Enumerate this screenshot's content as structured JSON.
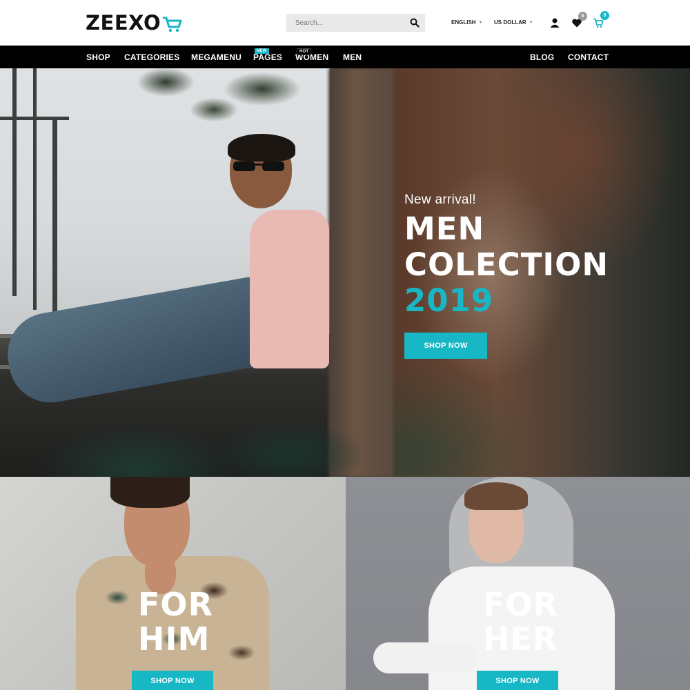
{
  "header": {
    "logo_text": "ZEEXO",
    "search_placeholder": "Search...",
    "language": "ENGLISH",
    "currency": "US DOLLAR",
    "wishlist_count": "0",
    "cart_count": "0"
  },
  "nav": {
    "items": [
      "SHOP",
      "CATEGORIES",
      "MEGAMENU",
      "PAGES",
      "WOMEN",
      "MEN"
    ],
    "right_items": [
      "BLOG",
      "CONTACT"
    ],
    "tags": {
      "pages": "NEW",
      "women": "HOT"
    }
  },
  "hero": {
    "subtitle": "New arrival!",
    "title_line1": "MEN",
    "title_line2": "COLECTION",
    "year": "2019",
    "button": "SHOP NOW"
  },
  "banners": [
    {
      "line1": "FOR",
      "line2": "HIM",
      "button": "SHOP NOW"
    },
    {
      "line1": "FOR",
      "line2": "HER",
      "button": "SHOP NOW"
    }
  ],
  "colors": {
    "accent": "#17b7c5",
    "nav_bg": "#000000",
    "hot_tag": "#000000",
    "new_tag": "#1bb7c6",
    "wishlist_badge": "#9a9a9a"
  }
}
